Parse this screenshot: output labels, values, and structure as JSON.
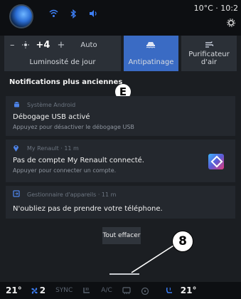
{
  "status_bar": {
    "temp_time": "10°C · 10:2",
    "icons": [
      "wifi-icon",
      "bluetooth-icon",
      "volume-icon"
    ],
    "settings_icon": "gear-icon"
  },
  "quick_panel": {
    "brightness": {
      "minus": "–",
      "icon": "sun-icon",
      "value": "+4",
      "plus": "+",
      "auto_label": "Auto",
      "label": "Luminosité de jour"
    },
    "traction": {
      "icon": "traction-icon",
      "label": "Antipatinage",
      "active": true
    },
    "air_purifier": {
      "icon": "air-purifier-icon",
      "label_line1": "Purificateur",
      "label_line2": "d'air"
    }
  },
  "notifications": {
    "section_title": "Notifications plus anciennes",
    "callout_e": "E",
    "items": [
      {
        "icon": "android-icon",
        "source": "Système Android",
        "title": "Débogage USB activé",
        "subtitle": "Appuyez pour désactiver le débogage USB"
      },
      {
        "icon": "location-icon",
        "source": "My Renault · 11 m",
        "title": "Pas de compte My Renault connecté.",
        "subtitle": "Appuyer pour connecter un compte.",
        "logo": "renault-logo"
      },
      {
        "icon": "device-manager-icon",
        "source": "Gestionnaire d'appareils · 11 m",
        "title": "N'oubliez pas de prendre votre téléphone."
      }
    ],
    "clear_all_label": "Tout effacer",
    "callout_8": "8"
  },
  "climate_bar": {
    "left_temp": "21°",
    "fan_level": "2",
    "sync_label": "SYNC",
    "ac_label": "A/C",
    "right_temp": "21°",
    "colors": {
      "accent": "#3d7ff5",
      "active_tile": "#3a6bc4"
    }
  }
}
